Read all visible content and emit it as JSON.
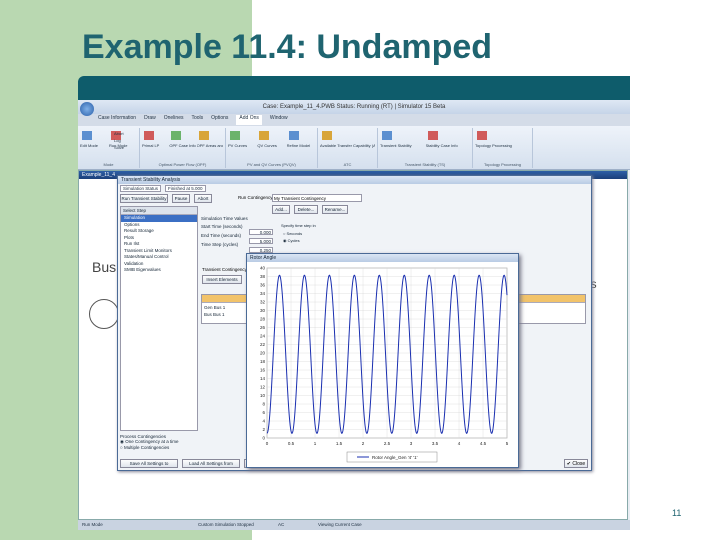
{
  "slide": {
    "title": "Example 11.4: Undamped",
    "page_number": "11"
  },
  "app": {
    "window_title": "Case: Example_11_4.PWB  Status: Running (RT)  |  Simulator 15 Beta",
    "ribbon_tabs": [
      "Case Information",
      "Draw",
      "Onelines",
      "Tools",
      "Options",
      "Add Ons",
      "Window"
    ],
    "active_tab": "Add Ons",
    "ribbon_groups": [
      {
        "label": "Mode",
        "buttons": [
          "Edit Mode",
          "Run Mode"
        ],
        "small": [
          "Abort",
          "Log",
          "Solve"
        ]
      },
      {
        "label": "Optimal Power Flow (OPF)",
        "buttons": [
          "Primal LP",
          "OPF Case Info",
          "OPF Areas and Regions"
        ]
      },
      {
        "label": "PV and QV Curves (PVQV)",
        "buttons": [
          "PV Curves",
          "QV Curves",
          "Refine Model"
        ]
      },
      {
        "label": "ATC",
        "buttons": [
          "Available Transfer Capability (ATC)"
        ]
      },
      {
        "label": "Transient Stability (TS)",
        "buttons": [
          "Transient Stability",
          "Stability Case Info"
        ]
      },
      {
        "label": "Topology Processing",
        "buttons": [
          "Topology Processing"
        ]
      }
    ],
    "status_bar": [
      "Run Mode",
      "Custom Simulation Stopped",
      "AC",
      "Viewing Current Case"
    ],
    "oneline": {
      "title": "Example_11_4",
      "bus_label": "Bus",
      "right_text": "ns"
    },
    "tsa": {
      "title": "Transient Stability Analysis",
      "top_tabs": [
        "Simulation Status",
        "Finished at 5.000"
      ],
      "run_button": "Run Transient Stability",
      "pause_button": "Pause",
      "abort_button": "Abort",
      "contingency_label": "Run Contingency:",
      "contingency_value": "My Transient Contingency",
      "add_button": "Add...",
      "delete_button": "Delete...",
      "rename_button": "Rename...",
      "select_step": "Select Step",
      "tree_items": [
        "Simulation",
        "Options",
        "Result Storage",
        "Plots",
        "Run Ilst",
        "Transient Limit Monitors",
        "States/Manual Control",
        "Validation",
        "SMIB Eigenvalues"
      ],
      "selected_item": "Simulation",
      "sim_tab": "Simulation",
      "sim_time_header": "Simulation Time Values",
      "start_time_label": "Start Time (seconds)",
      "start_time_value": "0.000",
      "end_time_label": "End Time (seconds)",
      "end_time_value": "5.000",
      "time_step_label": "Time Step (cycles)",
      "time_step_value": "0.250",
      "specify_label": "Specify time step in",
      "radio_seconds": "Seconds",
      "radio_cycles": "Cycles",
      "contingency_header": "Transient Contingency Elements",
      "insert_elements": "Insert Elements",
      "show_all": "Show All",
      "object_col": "Object",
      "grid_rows": [
        "Gen Bus 1",
        "Bus Bus 1"
      ],
      "process_header": "Process Contingencies",
      "process_one": "One Contingency at a time",
      "process_multi": "Multiple Contingencies",
      "save_all": "Save All Settings to",
      "load_all": "Load All Settings from",
      "show_trans": "Show Tran",
      "close": "Close"
    },
    "plot": {
      "title": "Rotor Angle",
      "legend": "Rotor Angle_Gen '4' '1'"
    }
  },
  "chart_data": {
    "type": "line",
    "title": "",
    "xlabel": "",
    "ylabel": "",
    "xlim": [
      0,
      5
    ],
    "ylim": [
      0,
      40
    ],
    "x_ticks": [
      "0",
      "0.5",
      "1",
      "1.5",
      "2",
      "2.5",
      "3",
      "3.5",
      "4",
      "4.5",
      "5"
    ],
    "y_ticks": [
      "0",
      "2",
      "4",
      "6",
      "8",
      "10",
      "12",
      "14",
      "16",
      "18",
      "20",
      "22",
      "24",
      "26",
      "28",
      "30",
      "32",
      "34",
      "36",
      "38",
      "40"
    ],
    "series": [
      {
        "name": "Rotor Angle_Gen '4' '1'",
        "color": "#1a2fb0",
        "function": "undamped sinusoid",
        "mean": 19.7,
        "amplitude": 18.6,
        "period": 0.52,
        "phase_start": "minimum at t=0"
      }
    ],
    "grid": true,
    "legend": "bottom"
  }
}
